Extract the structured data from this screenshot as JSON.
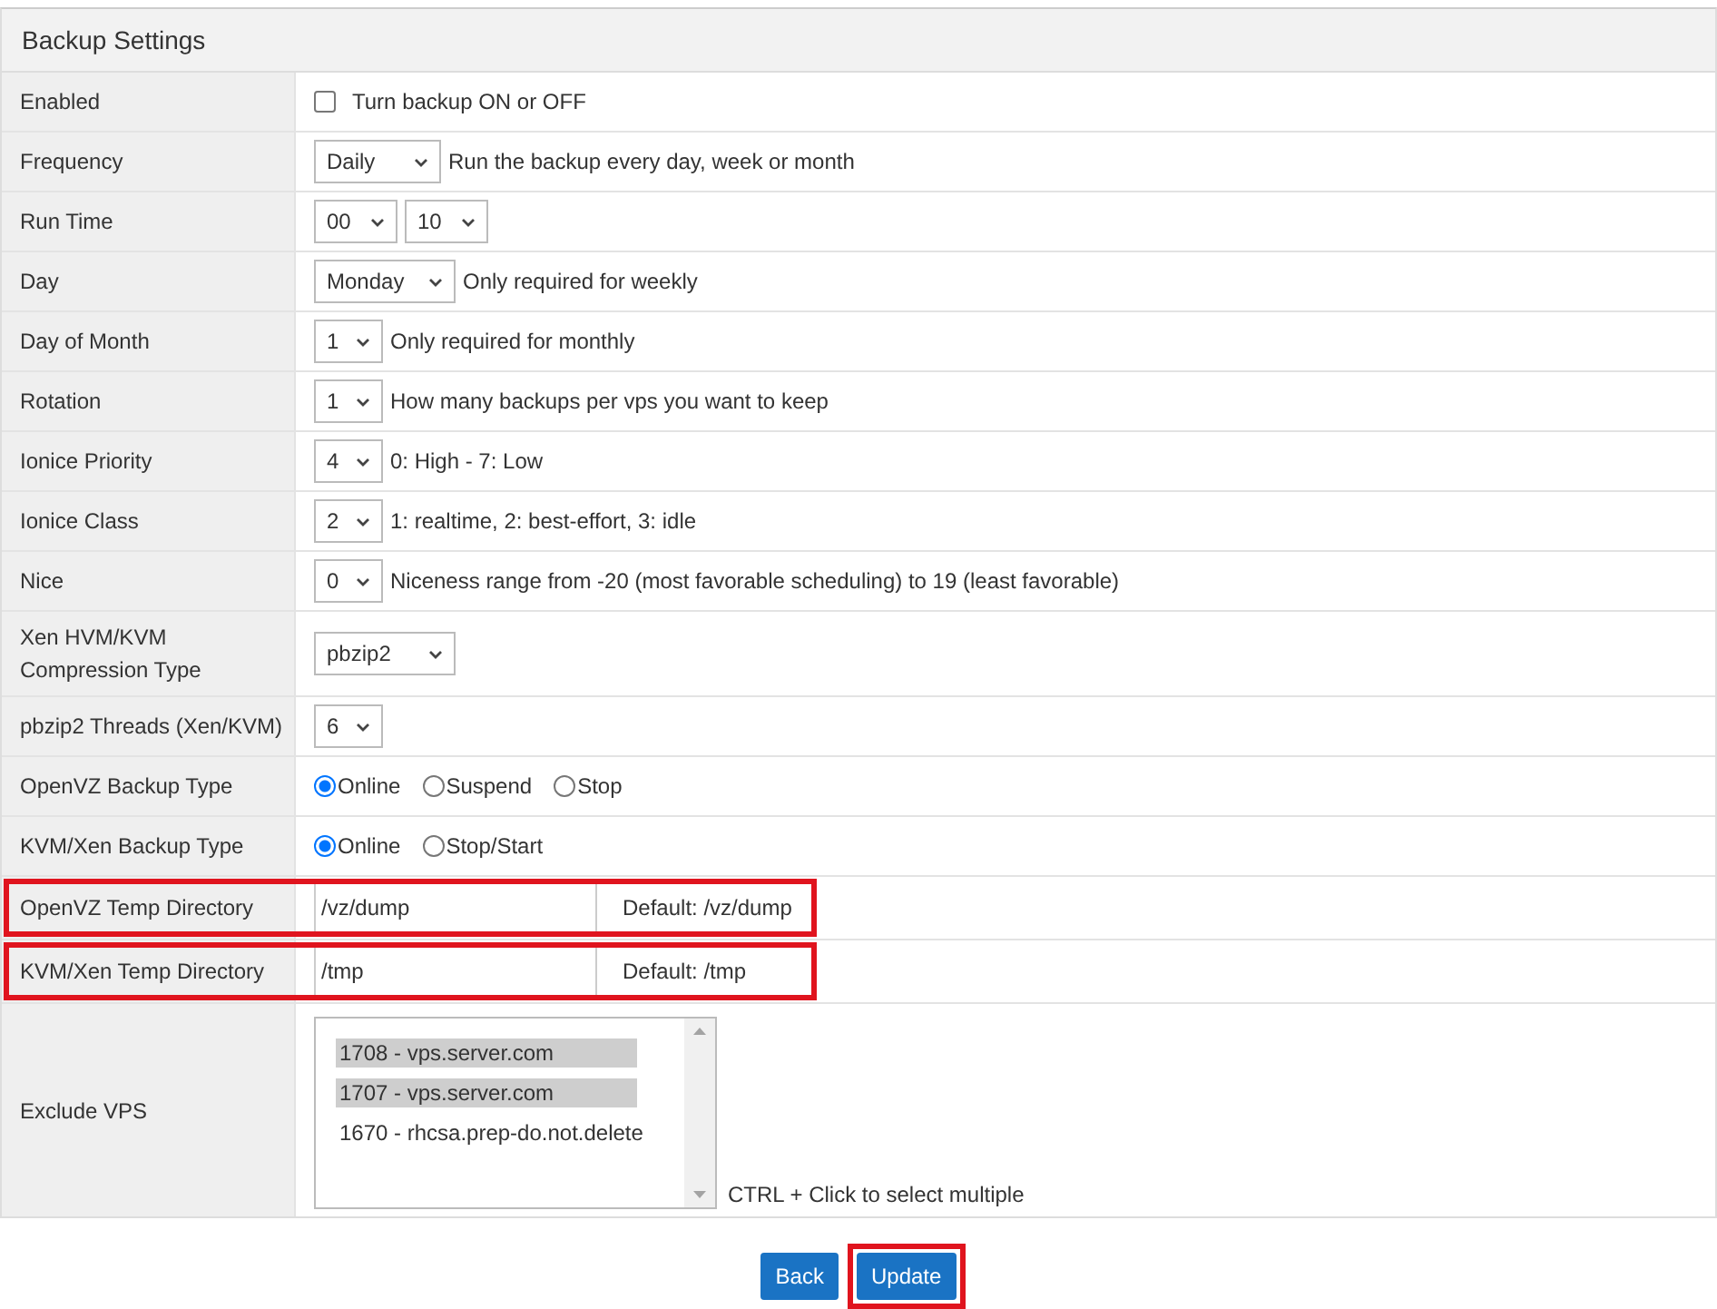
{
  "title": "Backup Settings",
  "rows": [
    {
      "label": "Enabled",
      "kind": "checkbox",
      "checked": false,
      "hint": "Turn backup ON or OFF"
    },
    {
      "label": "Frequency",
      "kind": "select",
      "selects": [
        "Daily"
      ],
      "hint": "Run the backup every day, week or month"
    },
    {
      "label": "Run Time",
      "kind": "select",
      "selects": [
        "00",
        "10"
      ]
    },
    {
      "label": "Day",
      "kind": "select",
      "selects": [
        "Monday"
      ],
      "hint": "Only required for weekly"
    },
    {
      "label": "Day of Month",
      "kind": "select",
      "selects": [
        "1"
      ],
      "hint": "Only required for monthly"
    },
    {
      "label": "Rotation",
      "kind": "select",
      "selects": [
        "1"
      ],
      "hint": "How many backups per vps you want to keep"
    },
    {
      "label": "Ionice Priority",
      "kind": "select",
      "selects": [
        "4"
      ],
      "hint": "0: High - 7: Low"
    },
    {
      "label": "Ionice Class",
      "kind": "select",
      "selects": [
        "2"
      ],
      "hint": "1: realtime, 2: best-effort, 3: idle"
    },
    {
      "label": "Nice",
      "kind": "select",
      "selects": [
        "0"
      ],
      "hint": "Niceness range from -20 (most favorable scheduling) to 19 (least favorable)"
    },
    {
      "label": "Xen HVM/KVM Compression Type",
      "kind": "select",
      "selects": [
        "pbzip2"
      ]
    },
    {
      "label": "pbzip2 Threads (Xen/KVM)",
      "kind": "select",
      "selects": [
        "6"
      ]
    },
    {
      "label": "OpenVZ Backup Type",
      "kind": "radio",
      "options": [
        {
          "label": "Online",
          "selected": true
        },
        {
          "label": "Suspend",
          "selected": false
        },
        {
          "label": "Stop",
          "selected": false
        }
      ]
    },
    {
      "label": "KVM/Xen Backup Type",
      "kind": "radio",
      "options": [
        {
          "label": "Online",
          "selected": true
        },
        {
          "label": "Stop/Start",
          "selected": false
        }
      ]
    },
    {
      "label": "OpenVZ Temp Directory",
      "kind": "text",
      "value": "/vz/dump",
      "hint": "Default: /vz/dump",
      "highlighted": true
    },
    {
      "label": "KVM/Xen Temp Directory",
      "kind": "text",
      "value": "/tmp",
      "hint": "Default: /tmp",
      "highlighted": true
    },
    {
      "label": "Exclude VPS",
      "kind": "listbox",
      "options": [
        {
          "label": "1708 - vps.server.com",
          "selected": true
        },
        {
          "label": "1707 - vps.server.com",
          "selected": true
        },
        {
          "label": "1670 - rhcsa.prep-do.not.delete",
          "selected": false
        }
      ],
      "hint": "CTRL + Click to select multiple"
    }
  ],
  "buttons": [
    {
      "label": "Back",
      "highlighted": false
    },
    {
      "label": "Update",
      "highlighted": true
    }
  ]
}
